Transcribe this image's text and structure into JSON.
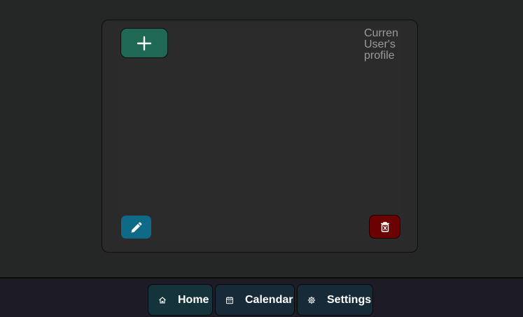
{
  "card": {
    "profile_text_lines": [
      "Curren",
      "User's",
      "profile"
    ]
  },
  "colors": {
    "page_bg": "#252726",
    "card_bg": "#2a2a2a",
    "add_button": "#1e6854",
    "edit_button": "#0e6a86",
    "delete_button": "#6b0202",
    "nav_bar_bg": "#1c1b26",
    "nav_button_bg": "#162a37",
    "nav_button_active_bg": "#15333a"
  },
  "icons": {
    "add": "plus-icon",
    "edit": "pencil-icon",
    "delete": "trash-icon"
  },
  "nav": {
    "items": [
      {
        "label": "Home",
        "icon": "home-icon",
        "active": true
      },
      {
        "label": "Calendar",
        "icon": "calendar-icon",
        "active": false
      },
      {
        "label": "Settings",
        "icon": "gear-icon",
        "active": false
      }
    ]
  }
}
